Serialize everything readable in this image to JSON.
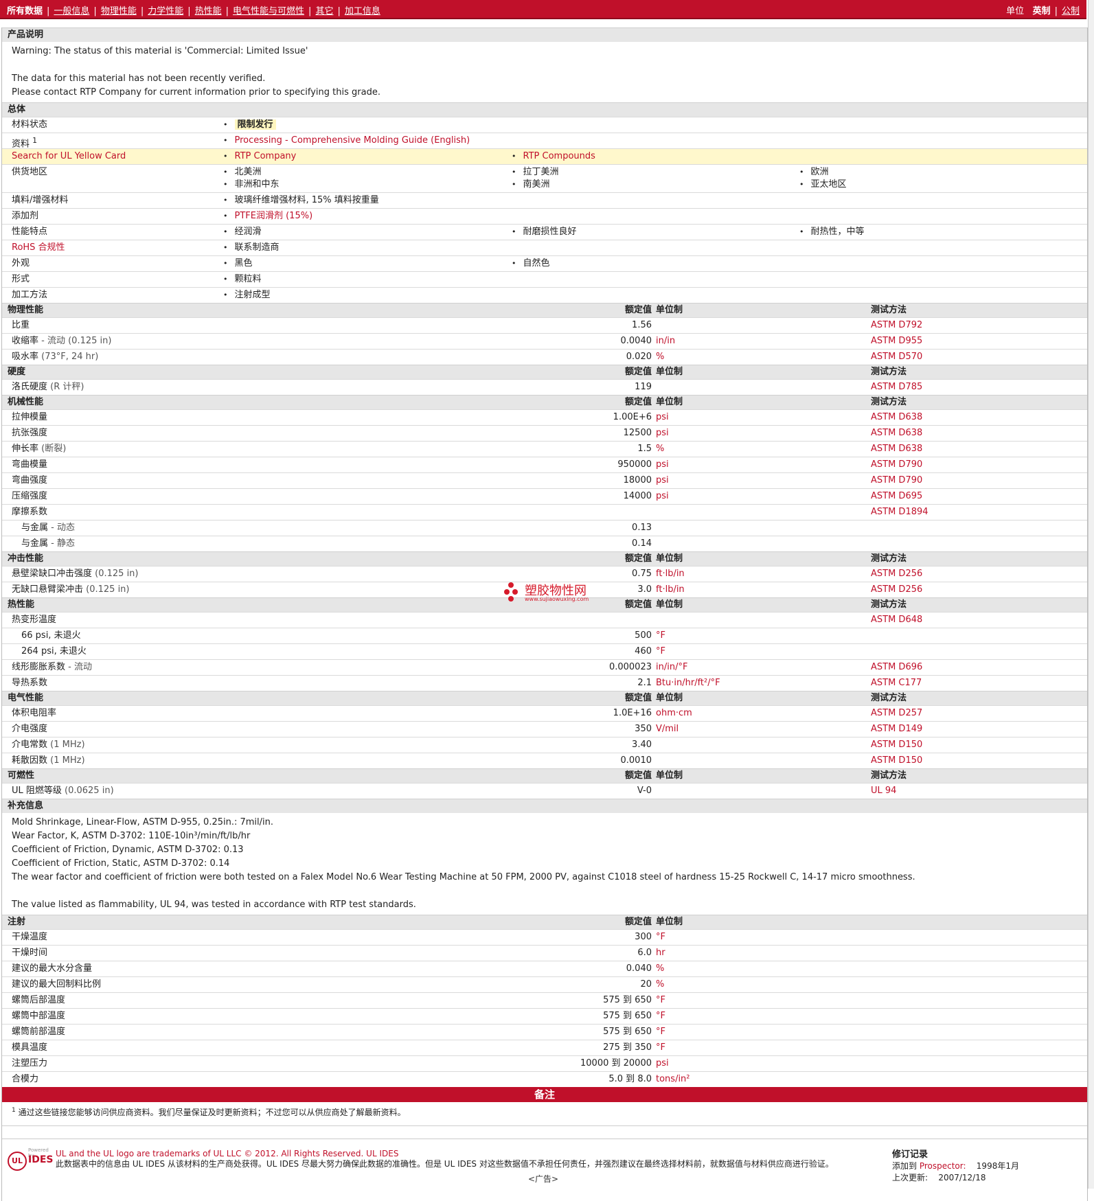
{
  "nav": {
    "all_data": "所有数据",
    "tabs": [
      "一般信息",
      "物理性能",
      "力学性能",
      "热性能",
      "电气性能与可燃性",
      "其它",
      "加工信息"
    ],
    "units_label": "单位",
    "unit_english": "英制",
    "unit_metric": "公制"
  },
  "product": {
    "heading": "产品说明",
    "lines": [
      "Warning: The status of this material is 'Commercial: Limited Issue'",
      "The data for this material has not been recently verified.",
      "Please contact RTP Company for current information prior to specifying this grade."
    ]
  },
  "general": {
    "heading": "总体",
    "status_label": "材料状态",
    "status_value": "限制发行",
    "docs_label": "资料",
    "docs_sup": "1",
    "docs_value": "Processing - Comprehensive Molding Guide (English)",
    "ul_label": "Search for UL Yellow Card",
    "ul_values": [
      "RTP Company",
      "RTP Compounds"
    ],
    "supply_label": "供货地区",
    "supply_values": [
      "北美洲",
      "拉丁美洲",
      "欧洲",
      "非洲和中东",
      "南美洲",
      "亚太地区"
    ],
    "filler_label": "填料/增强材料",
    "filler_value": "玻璃纤维增强材料, 15% 填料按重量",
    "additive_label": "添加剂",
    "additive_value": "PTFE润滑剂 (15%)",
    "features_label": "性能特点",
    "features_values": [
      "经润滑",
      "耐磨损性良好",
      "耐热性，中等"
    ],
    "rohs_label": "RoHS 合规性",
    "rohs_value": "联系制造商",
    "appearance_label": "外观",
    "appearance_values": [
      "黑色",
      "自然色"
    ],
    "form_label": "形式",
    "form_value": "颗粒料",
    "process_label": "加工方法",
    "process_value": "注射成型"
  },
  "headers": {
    "value": "额定值",
    "unit": "单位制",
    "method": "测试方法"
  },
  "physical": {
    "heading": "物理性能",
    "rows": [
      {
        "label": "比重",
        "cond": "",
        "value": "1.56",
        "unit": "",
        "method": "ASTM D792"
      },
      {
        "label": "收缩率",
        "cond": " - 流动 (0.125 in)",
        "value": "0.0040",
        "unit": "in/in",
        "method": "ASTM D955"
      },
      {
        "label": "吸水率",
        "cond": " (73°F, 24 hr)",
        "value": "0.020",
        "unit": "%",
        "method": "ASTM D570"
      }
    ]
  },
  "hardness": {
    "heading": "硬度",
    "rows": [
      {
        "label": "洛氏硬度",
        "cond": " (R 计秤)",
        "value": "119",
        "unit": "",
        "method": "ASTM D785"
      }
    ]
  },
  "mechanical": {
    "heading": "机械性能",
    "rows": [
      {
        "label": "拉伸模量",
        "cond": "",
        "value": "1.00E+6",
        "unit": "psi",
        "method": "ASTM D638"
      },
      {
        "label": "抗张强度",
        "cond": "",
        "value": "12500",
        "unit": "psi",
        "method": "ASTM D638"
      },
      {
        "label": "伸长率",
        "cond": " (断裂)",
        "value": "1.5",
        "unit": "%",
        "method": "ASTM D638"
      },
      {
        "label": "弯曲模量",
        "cond": "",
        "value": "950000",
        "unit": "psi",
        "method": "ASTM D790"
      },
      {
        "label": "弯曲强度",
        "cond": "",
        "value": "18000",
        "unit": "psi",
        "method": "ASTM D790"
      },
      {
        "label": "压缩强度",
        "cond": "",
        "value": "14000",
        "unit": "psi",
        "method": "ASTM D695"
      },
      {
        "label": "摩擦系数",
        "cond": "",
        "value": "",
        "unit": "",
        "method": "ASTM D1894"
      },
      {
        "label": "与金属",
        "cond": " - 动态",
        "value": "0.13",
        "unit": "",
        "method": "",
        "indent": true
      },
      {
        "label": "与金属",
        "cond": " - 静态",
        "value": "0.14",
        "unit": "",
        "method": "",
        "indent": true
      }
    ]
  },
  "impact": {
    "heading": "冲击性能",
    "rows": [
      {
        "label": "悬壁梁缺口冲击强度",
        "cond": " (0.125 in)",
        "value": "0.75",
        "unit": "ft·lb/in",
        "method": "ASTM D256"
      },
      {
        "label": "无缺口悬臂梁冲击",
        "cond": " (0.125 in)",
        "value": "3.0",
        "unit": "ft·lb/in",
        "method": "ASTM D256"
      }
    ]
  },
  "thermal": {
    "heading": "热性能",
    "rows": [
      {
        "label": "热变形温度",
        "cond": "",
        "value": "",
        "unit": "",
        "method": "ASTM D648"
      },
      {
        "label": "66 psi, 未退火",
        "cond": "",
        "value": "500",
        "unit": "°F",
        "method": "",
        "indent": true
      },
      {
        "label": "264 psi, 未退火",
        "cond": "",
        "value": "460",
        "unit": "°F",
        "method": "",
        "indent": true
      },
      {
        "label": "线形膨胀系数",
        "cond": " - 流动",
        "value": "0.000023",
        "unit": "in/in/°F",
        "method": "ASTM D696"
      },
      {
        "label": "导热系数",
        "cond": "",
        "value": "2.1",
        "unit": "Btu·in/hr/ft²/°F",
        "method": "ASTM C177"
      }
    ]
  },
  "electrical": {
    "heading": "电气性能",
    "rows": [
      {
        "label": "体积电阻率",
        "cond": "",
        "value": "1.0E+16",
        "unit": "ohm·cm",
        "method": "ASTM D257"
      },
      {
        "label": "介电强度",
        "cond": "",
        "value": "350",
        "unit": "V/mil",
        "method": "ASTM D149"
      },
      {
        "label": "介电常数",
        "cond": " (1 MHz)",
        "value": "3.40",
        "unit": "",
        "method": "ASTM D150"
      },
      {
        "label": "耗散因数",
        "cond": " (1 MHz)",
        "value": "0.0010",
        "unit": "",
        "method": "ASTM D150"
      }
    ]
  },
  "flammability": {
    "heading": "可燃性",
    "rows": [
      {
        "label": "UL 阻燃等级",
        "cond": " (0.0625 in)",
        "value": "V-0",
        "unit": "",
        "method": "UL 94"
      }
    ]
  },
  "supplemental": {
    "heading": "补充信息",
    "lines": [
      "Mold Shrinkage, Linear-Flow, ASTM D-955, 0.25in.: 7mil/in.",
      "Wear Factor, K, ASTM D-3702: 110E-10in³/min/ft/lb/hr",
      "Coefficient of Friction, Dynamic, ASTM D-3702: 0.13",
      "Coefficient of Friction, Static, ASTM D-3702: 0.14",
      "The wear factor and coefficient of friction were both tested on a Falex Model No.6 Wear Testing Machine at 50 FPM, 2000 PV, against C1018 steel of hardness 15-25 Rockwell C, 14-17 micro smoothness.",
      "The value listed as flammability, UL 94, was tested in accordance with RTP test standards."
    ]
  },
  "injection": {
    "heading": "注射",
    "rows": [
      {
        "label": "干燥温度",
        "value": "300",
        "unit": "°F"
      },
      {
        "label": "干燥时间",
        "value": "6.0",
        "unit": "hr"
      },
      {
        "label": "建议的最大水分含量",
        "value": "0.040",
        "unit": "%"
      },
      {
        "label": "建议的最大回制料比例",
        "value": "20",
        "unit": "%"
      },
      {
        "label": "螺筒后部温度",
        "value": "575 到  650",
        "unit": "°F"
      },
      {
        "label": "螺筒中部温度",
        "value": "575 到  650",
        "unit": "°F"
      },
      {
        "label": "螺筒前部温度",
        "value": "575 到  650",
        "unit": "°F"
      },
      {
        "label": "模具温度",
        "value": "275 到  350",
        "unit": "°F"
      },
      {
        "label": "注塑压力",
        "value": "10000 到  20000",
        "unit": "psi"
      },
      {
        "label": "合模力",
        "value": "5.0 到  8.0",
        "unit": "tons/in²"
      }
    ]
  },
  "notes": {
    "heading": "备注",
    "sup": "1",
    "text": "通过这些链接您能够访问供应商资料。我们尽量保证及时更新资料；不过您可以从供应商处了解最新资料。"
  },
  "footer": {
    "powered_by": "Powered by",
    "logo_ul": "UL",
    "logo_ides": "IDES",
    "trademark": "UL and the UL logo are trademarks of UL LLC © 2012. All Rights Reserved. UL IDES",
    "disclaimer": "此数据表中的信息由 UL IDES 从该材料的生产商处获得。UL IDES 尽最大努力确保此数据的准确性。但是 UL IDES 对这些数据值不承担任何责任，并强烈建议在最终选择材料前，就数据值与材料供应商进行验证。",
    "rev_title": "修订记录",
    "added_label": "添加到 ",
    "added_app": "Prospector:",
    "added_date": "1998年1月",
    "updated_label": "上次更新:",
    "updated_date": "2007/12/18"
  },
  "ad": "<广告>",
  "watermark": {
    "title": "塑胶物性网",
    "url": "www.sujiaowuxing.com"
  },
  "colors": {
    "brand": "#c0102a",
    "section_bg": "#e6e6e6",
    "highlight": "#fff8cc"
  }
}
